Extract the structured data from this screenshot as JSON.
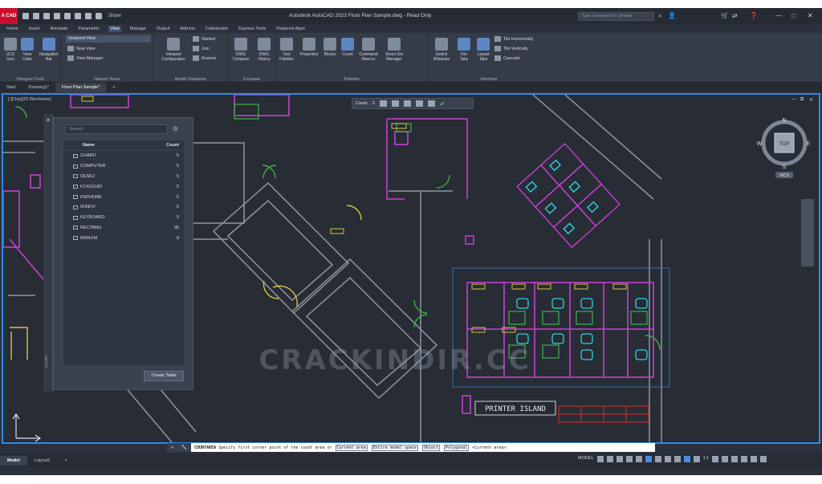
{
  "app": {
    "logo": "A CAD",
    "title": "Autodesk AutoCAD 2023   Floor Plan Sample.dwg - Read Only",
    "share": "Share",
    "search_placeholder": "Type a keyword or phrase"
  },
  "ribbon_tabs": [
    "Home",
    "Insert",
    "Annotate",
    "Parametric",
    "View",
    "Manage",
    "Output",
    "Add-ins",
    "Collaborate",
    "Express Tools",
    "Featured Apps"
  ],
  "ribbon_active_tab": "View",
  "ribbon": {
    "viewport_tools": {
      "label": "Viewport Tools",
      "ucs_icon": "UCS\nIcon",
      "view_cube": "View\nCube",
      "navigation_bar": "Navigation\nBar"
    },
    "named_views": {
      "label": "Named Views",
      "dropdown": "Unsaved View",
      "new_view": "New View",
      "view_manager": "View Manager"
    },
    "model_viewports": {
      "label": "Model Viewports",
      "viewport_configuration": "Viewport\nConfiguration",
      "named": "Named",
      "join": "Join",
      "restore": "Restore"
    },
    "compare": {
      "label": "Compare",
      "dwg_compare": "DWG\nCompare",
      "dwg_history": "DWG\nHistory"
    },
    "palettes": {
      "label": "Palettes",
      "tool_palettes": "Tool\nPalettes",
      "properties": "Properties",
      "blocks": "Blocks",
      "count": "Count",
      "command_macros": "Command\nMacros",
      "sheet_set_manager": "Sheet Set\nManager"
    },
    "interface": {
      "label": "Interface",
      "switch_windows": "Switch\nWindows",
      "file_tabs": "File\nTabs",
      "layout_tabs": "Layout\nTabs",
      "tile_horizontally": "Tile Horizontally",
      "tile_vertically": "Tile Vertically",
      "cascade": "Cascade"
    }
  },
  "file_tabs": [
    "Start",
    "Drawing1*",
    "Floor Plan Sample*"
  ],
  "file_tab_active": "Floor Plan Sample*",
  "viewport": {
    "label": "[-][Top][2D Wireframe]"
  },
  "count_toolbar": {
    "label": "Count",
    "value": "0"
  },
  "count_palette": {
    "search_placeholder": "Search",
    "col_name": "Name",
    "col_count": "Count",
    "items": [
      {
        "name": "CHAIR7",
        "count": "5"
      },
      {
        "name": "COMPUTER",
        "count": "5"
      },
      {
        "name": "DESK2",
        "count": "5"
      },
      {
        "name": "FC42X18D",
        "count": "5"
      },
      {
        "name": "FNPHONE",
        "count": "5"
      },
      {
        "name": "IDINFO",
        "count": "5"
      },
      {
        "name": "KEYBOARD",
        "count": "5"
      },
      {
        "name": "RECTANG",
        "count": "35"
      },
      {
        "name": "RMNUM",
        "count": "8"
      }
    ],
    "create_table": "Create Table",
    "strip_label": "COUNT"
  },
  "nav_cube": {
    "top": "TOP",
    "n": "N",
    "s": "S",
    "e": "E",
    "w": "W",
    "wcs": "WCS"
  },
  "drawing": {
    "printer_island": "PRINTER ISLAND",
    "watermark": "CRACKINDIR.CC"
  },
  "command_line": {
    "command": "COUNTAREA",
    "prompt": "Specify first corner point of the count area or",
    "options": [
      "Current area",
      "Entire model space",
      "Object",
      "Polygonal"
    ],
    "default": "<Current area>:"
  },
  "layout_tabs": [
    "Model",
    "Layout1"
  ],
  "layout_active": "Model",
  "status": {
    "model": "MODEL",
    "scale": "1:1",
    "annoscale": "1:1"
  },
  "colors": {
    "accent": "#2f89e8",
    "magenta": "#c93fd0",
    "green": "#3fb34a",
    "cyan": "#2fd3e3",
    "yellow": "#d7c640",
    "red": "#d3332f"
  }
}
